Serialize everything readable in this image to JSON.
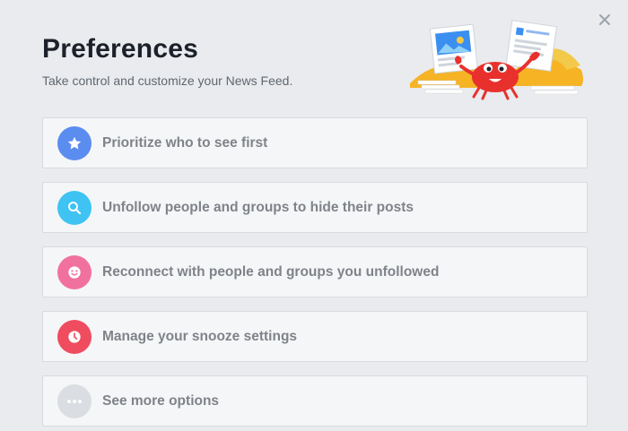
{
  "header": {
    "title": "Preferences",
    "subtitle": "Take control and customize your News Feed.",
    "close_icon": "close-icon"
  },
  "items": [
    {
      "label": "Prioritize who to see first",
      "icon": "star-icon",
      "color": "#5b8cf0"
    },
    {
      "label": "Unfollow people and groups to hide their posts",
      "icon": "search-icon",
      "color": "#3fc3f2"
    },
    {
      "label": "Reconnect with people and groups you unfollowed",
      "icon": "smile-icon",
      "color": "#f0719e"
    },
    {
      "label": "Manage your snooze settings",
      "icon": "clock-icon",
      "color": "#ef4c5f"
    },
    {
      "label": "See more options",
      "icon": "more-icon",
      "color": "#dadde1"
    }
  ],
  "colors": {
    "background": "#e9ebee",
    "title": "#1d2129",
    "item_text": "#7f8389"
  }
}
